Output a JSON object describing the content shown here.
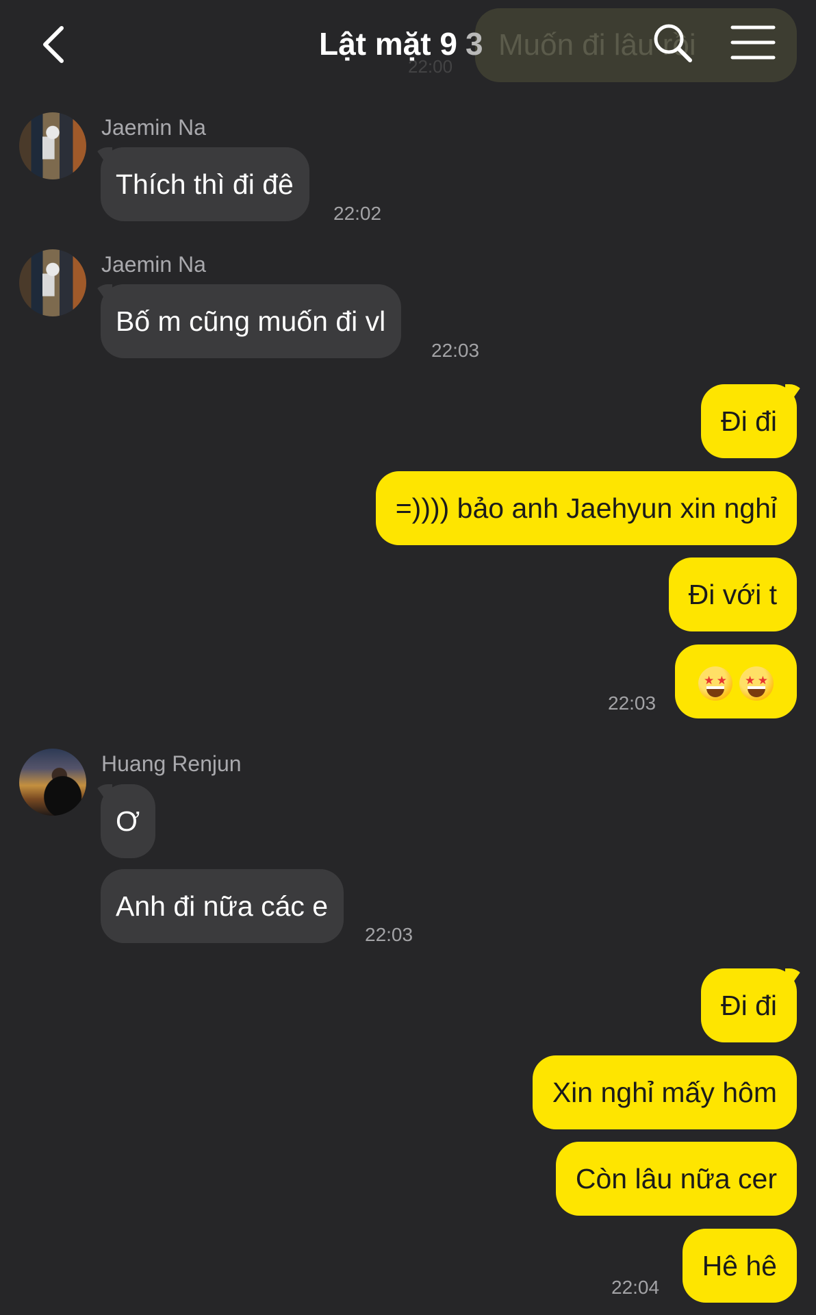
{
  "header": {
    "title": "Lật mặt 9",
    "member_count": "3",
    "ghost_preview_text": "Muốn đi lâu rồi",
    "ghost_preview_time": "22:00"
  },
  "icons": {
    "back": "chevron-left-icon",
    "search": "search-icon",
    "menu": "hamburger-menu-icon",
    "emoji": "star-struck-emoji"
  },
  "colors": {
    "background": "#262628",
    "incoming_bubble": "#3b3b3d",
    "outgoing_bubble": "#fee500",
    "timestamp": "#a3a3a6"
  },
  "messages": [
    {
      "sender": "Jaemin Na",
      "text": "Thích thì đi đê",
      "time": "22:02"
    },
    {
      "sender": "Jaemin Na",
      "text": "Bố m cũng muốn đi vl",
      "time": "22:03"
    },
    {
      "outgoing": [
        "Đi đi",
        "=)))) bảo anh Jaehyun xin nghỉ",
        "Đi với t"
      ],
      "time": "22:03"
    },
    {
      "sender": "Huang Renjun",
      "texts": [
        "Ơ",
        "Anh đi nữa các e"
      ],
      "time": "22:03"
    },
    {
      "outgoing": [
        "Đi đi",
        "Xin nghỉ mấy hôm",
        "Còn lâu nữa cer",
        "Hê hê"
      ],
      "time": "22:04"
    }
  ]
}
